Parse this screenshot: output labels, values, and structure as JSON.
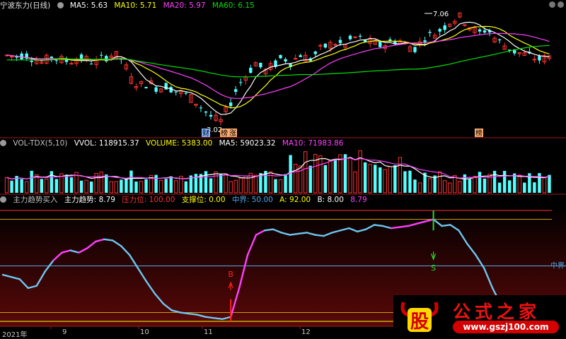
{
  "main_panel": {
    "stock_name": "宁波东力(日线)",
    "ma_items": [
      {
        "label": "MA5: 5.63",
        "color": "#ffffff"
      },
      {
        "label": "MA10: 5.71",
        "color": "#ffff00"
      },
      {
        "label": "MA20: 5.97",
        "color": "#ff40ff"
      },
      {
        "label": "MA60: 6.15",
        "color": "#00e000"
      }
    ],
    "high_label": "7.06",
    "low_label": "3.02",
    "marker_left": "财",
    "marker_mid1": "榜",
    "marker_mid2": "涨",
    "marker_right": "榜"
  },
  "vol_panel": {
    "items": [
      {
        "label": "VOL-TDX(5,10)",
        "color": "#c0c0c0"
      },
      {
        "label": "VVOL: 118915.37",
        "color": "#ffffff"
      },
      {
        "label": "VOLUME: 5383.00",
        "color": "#ffff00"
      },
      {
        "label": "MA5: 59023.32",
        "color": "#ffffff"
      },
      {
        "label": "MA10: 71983.86",
        "color": "#ff40ff"
      }
    ]
  },
  "ind_panel": {
    "items": [
      {
        "label": "主力趋势买入",
        "color": "#c0c0c0"
      },
      {
        "label": "主力趋势: 8.79",
        "color": "#ffffff"
      },
      {
        "label": "压力位: 100.00",
        "color": "#ff3030"
      },
      {
        "label": "支撑位: 0.00",
        "color": "#ffff00"
      },
      {
        "label": "中界: 50.00",
        "color": "#4fa8e8"
      },
      {
        "label": "A: 92.00",
        "color": "#ffff00"
      },
      {
        "label": "B: 8.00",
        "color": "#ffffff"
      },
      {
        "label": "8.79",
        "color": "#ff40ff"
      }
    ],
    "mid_label": "中界",
    "buy_label": "B",
    "sell_label": "S"
  },
  "x_axis": [
    "2021年",
    "9",
    "10",
    "11",
    "12"
  ],
  "watermark": {
    "title": "公式之家",
    "url": "www.gszj100.com",
    "logo_char": "股"
  },
  "colors": {
    "up": "#ff3232",
    "down": "#54ffff",
    "ma5": "#ffffff",
    "ma10": "#ffff00",
    "ma20": "#ff40ff",
    "ma60": "#00e000",
    "trend": "#6ec6f0",
    "trend_hot": "#ff40ff",
    "mid": "#4fa8e8"
  },
  "chart_data": [
    {
      "type": "candlestick",
      "title": "宁波东力(日线)",
      "series": [
        {
          "name": "MA5",
          "last": 5.63
        },
        {
          "name": "MA10",
          "last": 5.71
        },
        {
          "name": "MA20",
          "last": 5.97
        },
        {
          "name": "MA60",
          "last": 6.15
        }
      ],
      "annotations": [
        {
          "label": "7.06",
          "type": "high"
        },
        {
          "label": "3.02",
          "type": "low"
        }
      ],
      "close_path": [
        5.65,
        5.6,
        5.7,
        5.55,
        5.4,
        5.6,
        5.5,
        5.45,
        5.55,
        5.5,
        5.4,
        5.6,
        5.7,
        5.5,
        4.8,
        4.6,
        4.7,
        4.5,
        4.6,
        4.4,
        4.3,
        4.1,
        3.8,
        3.5,
        3.3,
        3.9,
        4.6,
        5.0,
        5.4,
        5.1,
        5.3,
        5.6,
        5.4,
        5.7,
        5.5,
        5.8,
        6.0,
        6.1,
        6.0,
        6.3,
        6.2,
        6.1,
        6.0,
        6.1,
        6.2,
        6.0,
        5.9,
        6.3,
        6.4,
        6.6,
        6.9,
        7.0,
        6.7,
        6.4,
        6.6,
        6.2,
        6.0,
        5.8,
        5.7,
        5.6,
        5.5,
        5.6
      ]
    },
    {
      "type": "bar",
      "title": "VOL-TDX(5,10)",
      "series": [
        {
          "name": "VVOL",
          "last": 118915.37
        },
        {
          "name": "VOLUME",
          "last": 5383.0
        },
        {
          "name": "MA5",
          "last": 59023.32
        },
        {
          "name": "MA10",
          "last": 71983.86
        }
      ]
    },
    {
      "type": "line",
      "title": "主力趋势买入",
      "ylim": [
        0,
        100
      ],
      "hlines": [
        {
          "name": "压力位",
          "value": 100
        },
        {
          "name": "中界",
          "value": 50
        },
        {
          "name": "支撑位",
          "value": 0
        }
      ],
      "series": [
        {
          "name": "主力趋势",
          "last": 8.79,
          "values": [
            42,
            40,
            38,
            30,
            32,
            45,
            55,
            62,
            64,
            62,
            66,
            72,
            74,
            73,
            68,
            60,
            48,
            36,
            25,
            16,
            10,
            8,
            7,
            6,
            4,
            3,
            2,
            4,
            30,
            60,
            78,
            82,
            83,
            80,
            78,
            79,
            80,
            78,
            77,
            80,
            82,
            84,
            81,
            83,
            87,
            86,
            84,
            85,
            86,
            88,
            90,
            92,
            86,
            87,
            82,
            70,
            60,
            48,
            30,
            15,
            8.79
          ]
        }
      ],
      "signals": [
        {
          "label": "B",
          "index": 27
        },
        {
          "label": "S",
          "index": 51
        }
      ]
    }
  ]
}
